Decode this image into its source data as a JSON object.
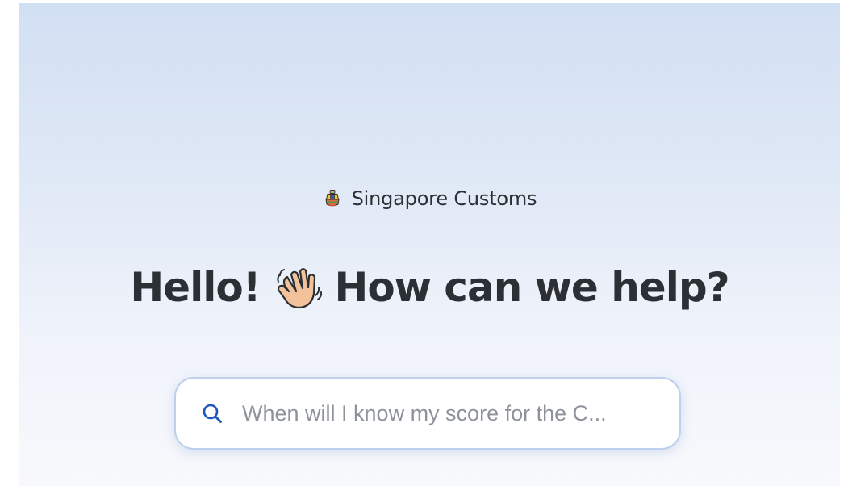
{
  "brand": {
    "name": "Singapore Customs",
    "logo_icon": "singapore-customs-crest-icon"
  },
  "headline": {
    "greeting": "Hello!",
    "wave_icon": "waving-hand-icon",
    "question": "How can we help?"
  },
  "search": {
    "icon": "search-icon",
    "placeholder": "When will I know my score for the C...",
    "value": ""
  },
  "colors": {
    "gradient_top": "#d2e0f3",
    "gradient_bottom": "#f8f9fc",
    "text": "#2c2f33",
    "accent": "#1f57b8",
    "placeholder": "#8d929b",
    "search_border": "#bcd0ee"
  }
}
